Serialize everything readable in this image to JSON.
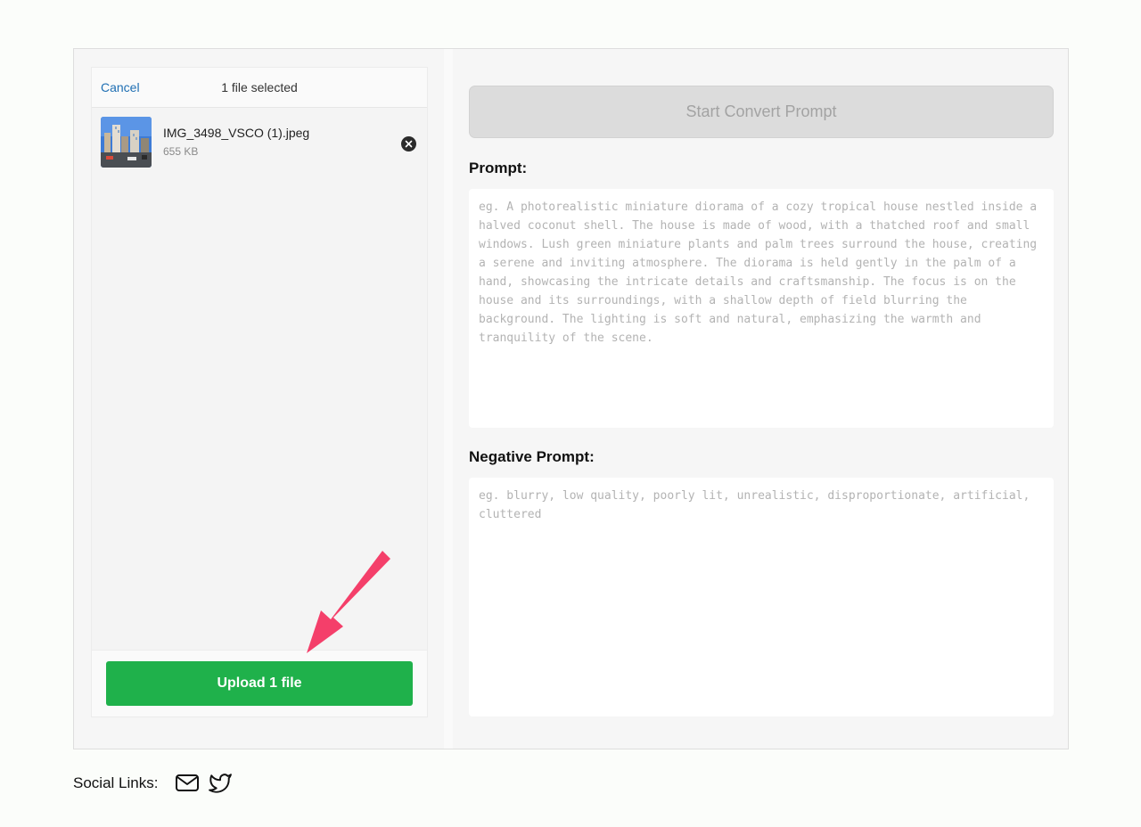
{
  "uploader": {
    "cancel_label": "Cancel",
    "selected_count": "1 file selected",
    "files": [
      {
        "name": "IMG_3498_VSCO (1).jpeg",
        "size": "655 KB"
      }
    ],
    "upload_label": "Upload 1 file"
  },
  "convert": {
    "start_label": "Start Convert Prompt",
    "prompt_label": "Prompt:",
    "prompt_placeholder": "eg. A photorealistic miniature diorama of a cozy tropical house nestled inside a halved coconut shell. The house is made of wood, with a thatched roof and small windows. Lush green miniature plants and palm trees surround the house, creating a serene and inviting atmosphere. The diorama is held gently in the palm of a hand, showcasing the intricate details and craftsmanship. The focus is on the house and its surroundings, with a shallow depth of field blurring the background. The lighting is soft and natural, emphasizing the warmth and tranquility of the scene.",
    "negative_label": "Negative Prompt:",
    "negative_placeholder": "eg. blurry, low quality, poorly lit, unrealistic, disproportionate, artificial, cluttered"
  },
  "social": {
    "label": "Social Links:",
    "icons": [
      "mail-icon",
      "twitter-icon"
    ]
  },
  "colors": {
    "accent_green": "#1fb14b",
    "link_blue": "#1f6fb3",
    "arrow_pink": "#f43f6a"
  }
}
